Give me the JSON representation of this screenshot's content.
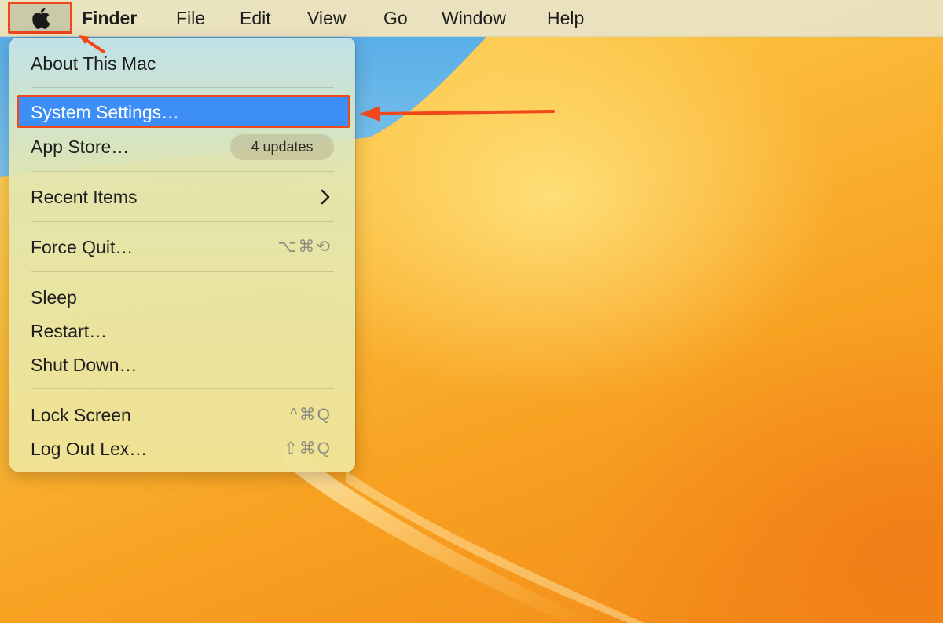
{
  "menubar": {
    "app_name": "Finder",
    "menus": [
      "File",
      "Edit",
      "View",
      "Go",
      "Window",
      "Help"
    ]
  },
  "apple_menu": {
    "about": "About This Mac",
    "system_settings": "System Settings…",
    "app_store": "App Store…",
    "app_store_badge": "4 updates",
    "recent_items": "Recent Items",
    "force_quit": "Force Quit…",
    "force_quit_shortcut": "⌥⌘⟲",
    "sleep": "Sleep",
    "restart": "Restart…",
    "shut_down": "Shut Down…",
    "lock_screen": "Lock Screen",
    "lock_screen_shortcut": "^⌘Q",
    "log_out": "Log Out Lex…",
    "log_out_shortcut": "⇧⌘Q"
  },
  "colors": {
    "highlight": "#3d8ff7",
    "annotation": "#f0471b"
  }
}
